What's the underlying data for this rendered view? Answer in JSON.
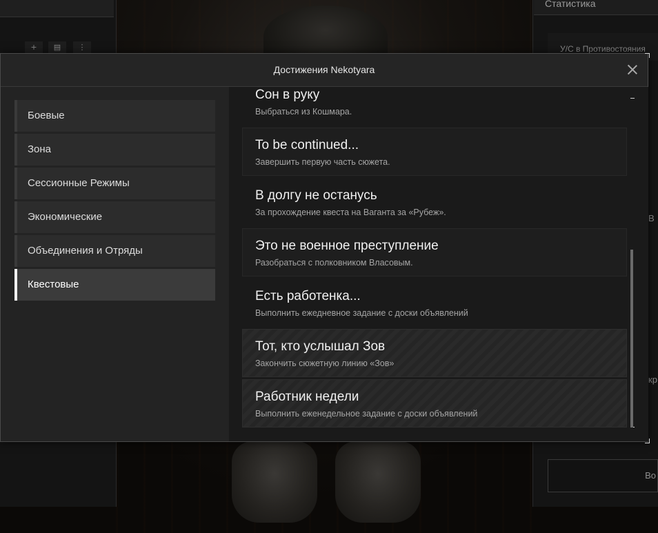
{
  "background": {
    "stats_title": "Статистика",
    "stats_row": "У/С в Противостояния",
    "right_fragments": [
      "В",
      "кр"
    ],
    "right_button": "Во"
  },
  "modal": {
    "title": "Достижения Nekotyara",
    "close_icon": "close-icon"
  },
  "categories": [
    {
      "label": "Боевые",
      "active": false
    },
    {
      "label": "Зона",
      "active": false
    },
    {
      "label": "Сессионные Режимы",
      "active": false
    },
    {
      "label": "Экономические",
      "active": false
    },
    {
      "label": "Объединения и Отряды",
      "active": false
    },
    {
      "label": "Квестовые",
      "active": true
    }
  ],
  "achievements": [
    {
      "title": "Сон в руку",
      "desc": "Выбраться из Кошмара.",
      "completed": false
    },
    {
      "title": "To be continued...",
      "desc": "Завершить первую часть сюжета.",
      "completed": false
    },
    {
      "title": "В долгу не останусь",
      "desc": "За прохождение квеста на Ваганта за «Рубеж».",
      "completed": false
    },
    {
      "title": "Это не военное преступление",
      "desc": "Разобраться с полковником Власовым.",
      "completed": false
    },
    {
      "title": "Есть работенка...",
      "desc": "Выполнить ежедневное задание с доски объявлений",
      "completed": false
    },
    {
      "title": "Тот, кто услышал Зов",
      "desc": "Закончить сюжетную линию «Зов»",
      "completed": true
    },
    {
      "title": "Работник недели",
      "desc": "Выполнить еженедельное задание с доски объявлений",
      "completed": true
    }
  ]
}
